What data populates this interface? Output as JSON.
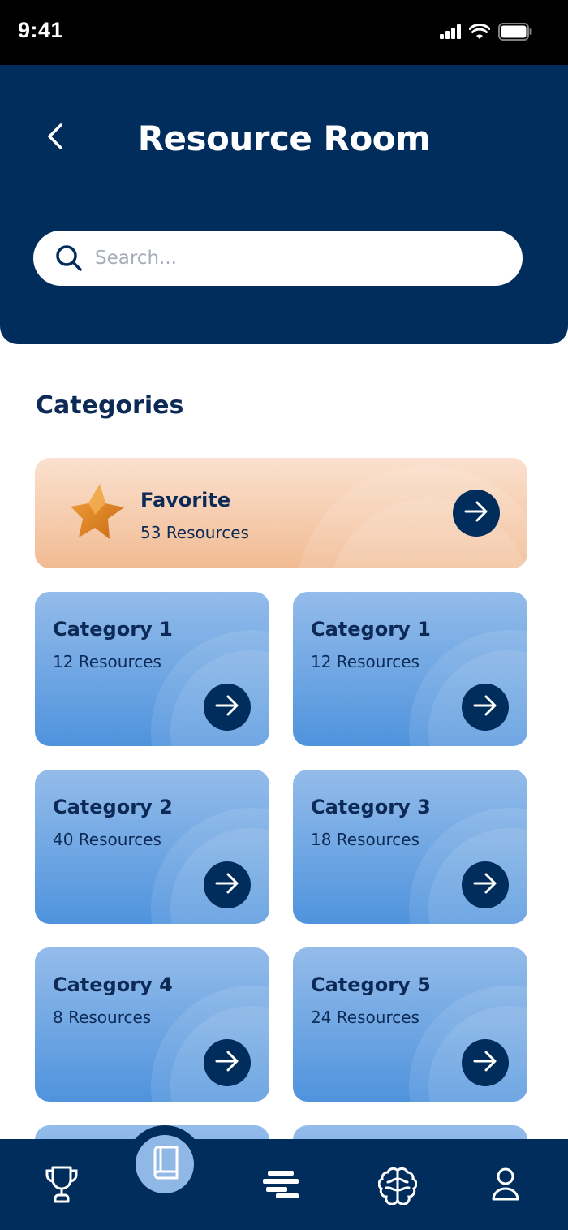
{
  "status_bar": {
    "time": "9:41"
  },
  "header": {
    "title": "Resource Room",
    "back_icon": "chevron-left-icon"
  },
  "search": {
    "placeholder": "Search...",
    "value": "",
    "icon": "search-icon"
  },
  "categories_section": {
    "title": "Categories"
  },
  "favorite": {
    "name": "Favorite",
    "count": "53 Resources",
    "icon": "star-icon"
  },
  "categories": [
    {
      "name": "Category 1",
      "count": "12 Resources"
    },
    {
      "name": "Category 1",
      "count": "12 Resources"
    },
    {
      "name": "Category 2",
      "count": "40 Resources"
    },
    {
      "name": "Category 3",
      "count": "18 Resources"
    },
    {
      "name": "Category 4",
      "count": "8 Resources"
    },
    {
      "name": "Category 5",
      "count": "24 Resources"
    },
    {
      "name": "",
      "count": ""
    },
    {
      "name": "",
      "count": ""
    }
  ],
  "bottom_nav": [
    {
      "icon": "trophy-icon",
      "active": false
    },
    {
      "icon": "book-icon",
      "active": true
    },
    {
      "icon": "list-icon",
      "active": false
    },
    {
      "icon": "brain-icon",
      "active": false
    },
    {
      "icon": "profile-icon",
      "active": false
    }
  ],
  "colors": {
    "navy": "#002d5c",
    "card_blue_top": "#94bcea",
    "card_blue_bottom": "#4f93dd",
    "favorite_top": "#fbe1cf",
    "favorite_bottom": "#f1bb93",
    "active_nav": "#8fb8e6"
  }
}
